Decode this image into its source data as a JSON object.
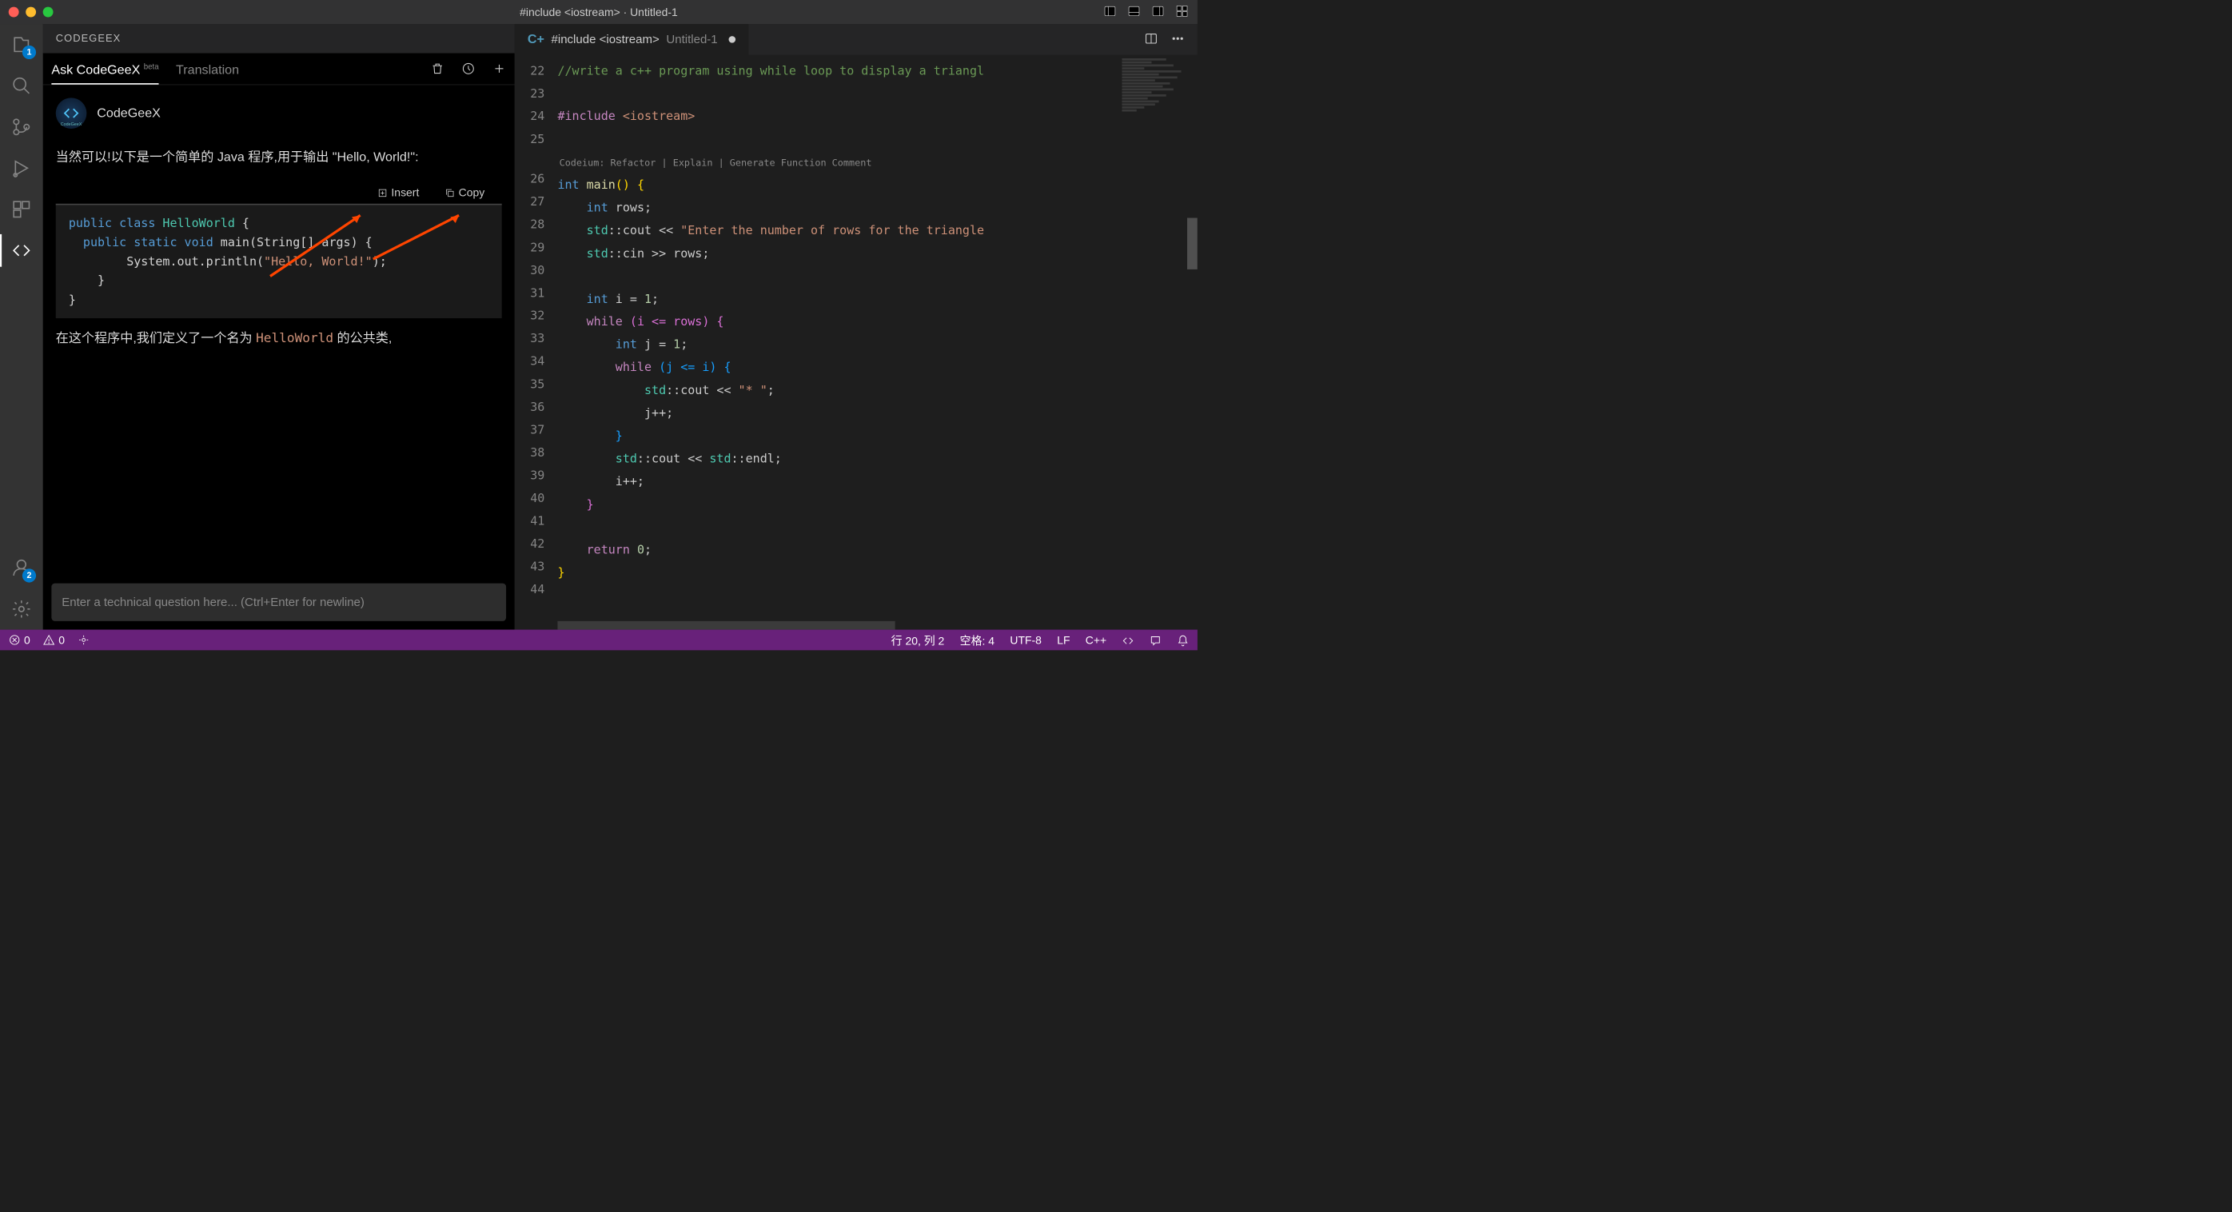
{
  "titlebar": {
    "title": "#include <iostream> · Untitled-1"
  },
  "activitybar": {
    "explorer_badge": "1",
    "accounts_badge": "2"
  },
  "sidebar": {
    "header": "CODEGEEX",
    "tabs": {
      "ask": "Ask CodeGeeX",
      "ask_super": "beta",
      "translation": "Translation"
    },
    "bot_name": "CodeGeeX",
    "response_pre": "当然可以!以下是一个简单的 Java 程序,用于输出 \"Hello, World!\":",
    "code_actions": {
      "insert": "Insert",
      "copy": "Copy"
    },
    "code_snippet": {
      "l1a": "public",
      "l1b": "class",
      "l1c": "HelloWorld",
      "l1d": " {",
      "l2a": "public",
      "l2b": "static",
      "l2c": "void",
      "l2d": " main(String[] args) {",
      "l3": "        System.out.println(",
      "l3s": "\"Hello, World!\"",
      "l3e": ");",
      "l4": "    }",
      "l5": "}"
    },
    "response_post_a": "在这个程序中,我们定义了一个名为 ",
    "response_post_code": "HelloWorld",
    "response_post_b": " 的公共类,",
    "input_placeholder": "Enter a technical question here... (Ctrl+Enter for newline)"
  },
  "editor": {
    "tab": {
      "filename": "#include <iostream>",
      "dim": "Untitled-1"
    },
    "line_numbers": [
      "22",
      "23",
      "24",
      "25",
      "26",
      "27",
      "28",
      "29",
      "30",
      "31",
      "32",
      "33",
      "34",
      "35",
      "36",
      "37",
      "38",
      "39",
      "40",
      "41",
      "42",
      "43",
      "44"
    ],
    "codelens": "Codeium: Refactor | Explain | Generate Function Comment",
    "lines": {
      "l22": "//write a c++ program using while loop to display a triangl",
      "l24_a": "#include",
      "l24_b": "<iostream>",
      "l26_a": "int",
      "l26_b": "main",
      "l26_c": "() {",
      "l27_a": "int",
      "l27_b": " rows;",
      "l28_a": "std",
      "l28_b": "::cout << ",
      "l28_c": "\"Enter the number of rows for the triangle",
      "l29_a": "std",
      "l29_b": "::cin >> rows;",
      "l31_a": "int",
      "l31_b": " i = ",
      "l31_c": "1",
      "l31_d": ";",
      "l32_a": "while",
      "l32_b": " (i <= rows) {",
      "l33_a": "int",
      "l33_b": " j = ",
      "l33_c": "1",
      "l33_d": ";",
      "l34_a": "while",
      "l34_b": " (j <= i) {",
      "l35_a": "std",
      "l35_b": "::cout << ",
      "l35_c": "\"* \"",
      "l35_d": ";",
      "l36": "j++;",
      "l37": "}",
      "l38_a": "std",
      "l38_b": "::cout << ",
      "l38_c": "std",
      "l38_d": "::endl;",
      "l39": "i++;",
      "l40": "}",
      "l42_a": "return",
      "l42_b": " ",
      "l42_c": "0",
      "l42_d": ";",
      "l43": "}"
    }
  },
  "statusbar": {
    "errors": "0",
    "warnings": "0",
    "cursor": "行 20, 列 2",
    "spaces": "空格: 4",
    "encoding": "UTF-8",
    "eol": "LF",
    "lang": "C++"
  }
}
